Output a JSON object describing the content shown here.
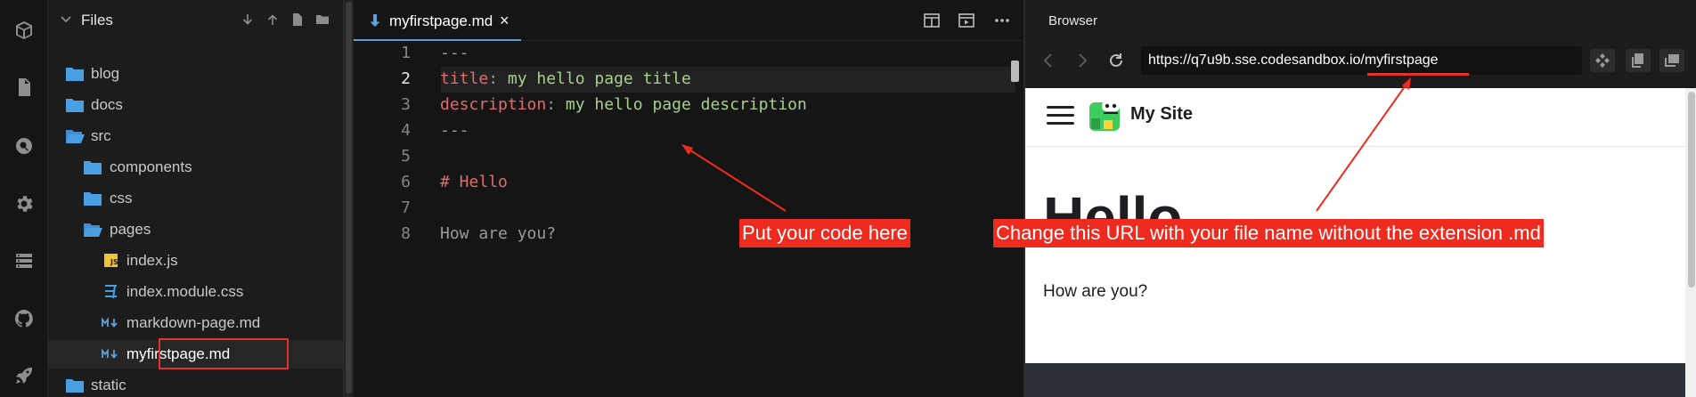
{
  "activity_bar": {
    "icons": [
      "box-icon",
      "file-icon",
      "search-icon",
      "gear-icon",
      "server-icon",
      "github-icon",
      "rocket-icon"
    ]
  },
  "explorer": {
    "title": "Files",
    "header_buttons": [
      "download-icon",
      "upload-icon",
      "new-file-icon",
      "new-folder-icon"
    ],
    "items": [
      {
        "label": "blog",
        "type": "folder",
        "depth": 0
      },
      {
        "label": "docs",
        "type": "folder",
        "depth": 0
      },
      {
        "label": "src",
        "type": "folder-open",
        "depth": 0
      },
      {
        "label": "components",
        "type": "folder",
        "depth": 1
      },
      {
        "label": "css",
        "type": "folder",
        "depth": 1
      },
      {
        "label": "pages",
        "type": "folder-open",
        "depth": 1
      },
      {
        "label": "index.js",
        "type": "js",
        "depth": 2
      },
      {
        "label": "index.module.css",
        "type": "css",
        "depth": 2
      },
      {
        "label": "markdown-page.md",
        "type": "md",
        "depth": 2
      },
      {
        "label": "myfirstpage.md",
        "type": "md",
        "depth": 2,
        "selected": true
      },
      {
        "label": "static",
        "type": "folder",
        "depth": 0
      }
    ]
  },
  "editor": {
    "tab": {
      "name": "myfirstpage.md",
      "close": "×"
    },
    "toolbar_icons": [
      "split-view-icon",
      "preview-icon",
      "more-icon"
    ],
    "active_line": 2,
    "lines": [
      {
        "num": "1",
        "parts": [
          {
            "t": "---",
            "c": "dim"
          }
        ]
      },
      {
        "num": "2",
        "parts": [
          {
            "t": "title",
            "c": "key"
          },
          {
            "t": ": ",
            "c": "dim"
          },
          {
            "t": "my hello page title",
            "c": "val"
          }
        ]
      },
      {
        "num": "3",
        "parts": [
          {
            "t": "description",
            "c": "key"
          },
          {
            "t": ": ",
            "c": "dim"
          },
          {
            "t": "my hello page description",
            "c": "val"
          }
        ]
      },
      {
        "num": "4",
        "parts": [
          {
            "t": "---",
            "c": "dim"
          }
        ]
      },
      {
        "num": "5",
        "parts": []
      },
      {
        "num": "6",
        "parts": [
          {
            "t": "# Hello",
            "c": "head"
          }
        ]
      },
      {
        "num": "7",
        "parts": []
      },
      {
        "num": "8",
        "parts": [
          {
            "t": "How are you?",
            "c": "dim"
          }
        ]
      }
    ]
  },
  "browser": {
    "title": "Browser",
    "url": "https://q7u9b.sse.codesandbox.io/myfirstpage",
    "site_name": "My Site",
    "heading": "Hello",
    "paragraph": "How are you?"
  },
  "annotations": {
    "code_note": "Put your code here",
    "url_note": "Change this URL with your file name without the  extension .md"
  },
  "colors": {
    "annotation_red": "#ef2b1f",
    "yaml_key": "#e06c6c",
    "yaml_value": "#a8d08d",
    "tab_accent": "#5fa0d8"
  }
}
